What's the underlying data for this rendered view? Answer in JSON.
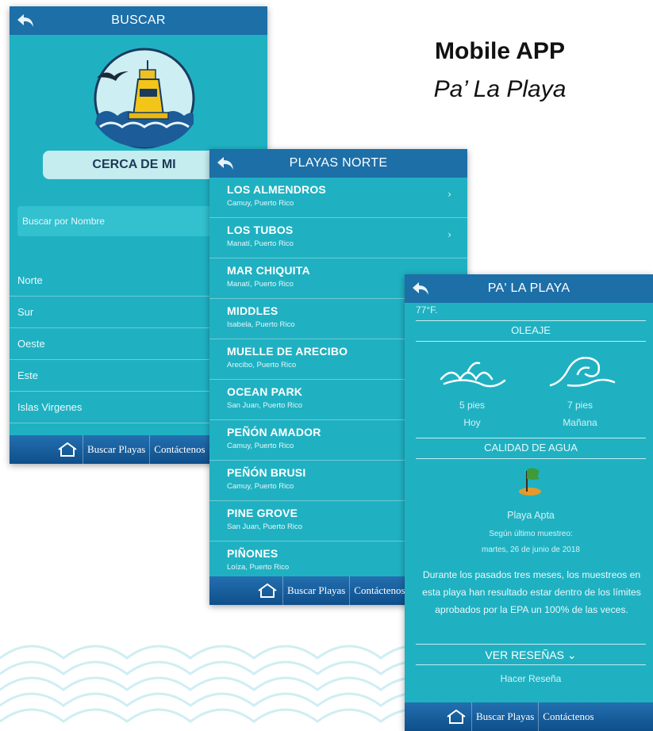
{
  "heading": {
    "title": "Mobile APP",
    "subtitle": "Pa’ La Playa"
  },
  "colors": {
    "teal": "#1fb1c2",
    "navbar": "#1d6fa8",
    "tabbar": "#0e4f8a"
  },
  "screen1": {
    "title": "BUSCAR",
    "nearby_button": "CERCA DE MI",
    "search_placeholder": "Buscar por Nombre",
    "search_clear": "x",
    "regions": [
      "Norte",
      "Sur",
      "Oeste",
      "Este",
      "Islas Virgenes"
    ],
    "tabs": {
      "search": "Buscar Playas",
      "contact": "Contáctenos"
    }
  },
  "screen2": {
    "title": "PLAYAS NORTE",
    "beaches": [
      {
        "name": "LOS ALMENDROS",
        "location": "Camuy, Puerto Rico"
      },
      {
        "name": "LOS TUBOS",
        "location": "Manatí, Puerto Rico"
      },
      {
        "name": "MAR CHIQUITA",
        "location": "Manatí, Puerto Rico"
      },
      {
        "name": "MIDDLES",
        "location": "Isabela, Puerto Rico"
      },
      {
        "name": "MUELLE DE ARECIBO",
        "location": "Arecibo, Puerto Rico"
      },
      {
        "name": "OCEAN PARK",
        "location": "San Juan, Puerto Rico"
      },
      {
        "name": "PEÑÓN AMADOR",
        "location": "Camuy, Puerto Rico"
      },
      {
        "name": "PEÑÓN BRUSI",
        "location": "Camuy, Puerto Rico"
      },
      {
        "name": "PINE GROVE",
        "location": "San Juan, Puerto Rico"
      },
      {
        "name": "PIÑONES",
        "location": "Loíza, Puerto Rico"
      }
    ],
    "tabs": {
      "search": "Buscar Playas",
      "contact": "Contáctenos"
    }
  },
  "screen3": {
    "title": "PA' LA PLAYA",
    "temperature": "77°F.",
    "waves_section": "OLEAJE",
    "today": {
      "height": "5 pies",
      "label": "Hoy"
    },
    "tomorrow": {
      "height": "7 pies",
      "label": "Mañana"
    },
    "water_section": "CALIDAD DE AGUA",
    "status": "Playa Apta",
    "sampling_label": "Según último muestreo:",
    "sampling_date": "martes, 26 de junio de 2018",
    "description": "Durante los pasados tres meses, los muestreos en esta playa han resultado estar dentro de los límites aprobados por la EPA un 100% de las veces.",
    "reviews_toggle": "VER RESEÑAS ⌄",
    "write_review": "Hacer Reseña",
    "tabs": {
      "search": "Buscar Playas",
      "contact": "Contáctenos"
    }
  }
}
